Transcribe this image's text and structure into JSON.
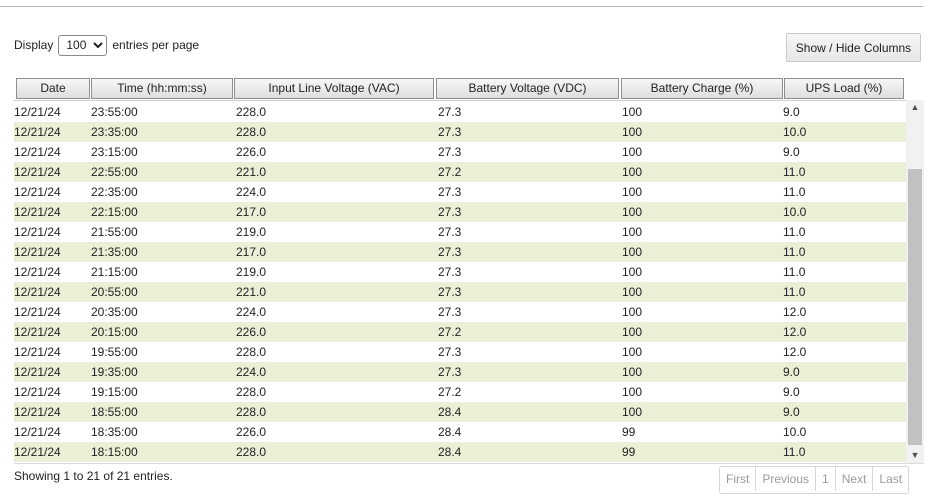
{
  "length_menu": {
    "prefix": "Display",
    "selected": "100",
    "suffix": "entries per page"
  },
  "colvis_label": "Show / Hide Columns",
  "columns": [
    "Date",
    "Time (hh:mm:ss)",
    "Input Line Voltage (VAC)",
    "Battery Voltage (VDC)",
    "Battery Charge (%)",
    "UPS Load (%)"
  ],
  "rows": [
    [
      "12/21/24",
      "23:55:00",
      "228.0",
      "27.3",
      "100",
      "9.0"
    ],
    [
      "12/21/24",
      "23:35:00",
      "228.0",
      "27.3",
      "100",
      "10.0"
    ],
    [
      "12/21/24",
      "23:15:00",
      "226.0",
      "27.3",
      "100",
      "9.0"
    ],
    [
      "12/21/24",
      "22:55:00",
      "221.0",
      "27.2",
      "100",
      "11.0"
    ],
    [
      "12/21/24",
      "22:35:00",
      "224.0",
      "27.3",
      "100",
      "11.0"
    ],
    [
      "12/21/24",
      "22:15:00",
      "217.0",
      "27.3",
      "100",
      "10.0"
    ],
    [
      "12/21/24",
      "21:55:00",
      "219.0",
      "27.3",
      "100",
      "11.0"
    ],
    [
      "12/21/24",
      "21:35:00",
      "217.0",
      "27.3",
      "100",
      "11.0"
    ],
    [
      "12/21/24",
      "21:15:00",
      "219.0",
      "27.3",
      "100",
      "11.0"
    ],
    [
      "12/21/24",
      "20:55:00",
      "221.0",
      "27.3",
      "100",
      "11.0"
    ],
    [
      "12/21/24",
      "20:35:00",
      "224.0",
      "27.3",
      "100",
      "12.0"
    ],
    [
      "12/21/24",
      "20:15:00",
      "226.0",
      "27.2",
      "100",
      "12.0"
    ],
    [
      "12/21/24",
      "19:55:00",
      "228.0",
      "27.3",
      "100",
      "12.0"
    ],
    [
      "12/21/24",
      "19:35:00",
      "224.0",
      "27.3",
      "100",
      "9.0"
    ],
    [
      "12/21/24",
      "19:15:00",
      "228.0",
      "27.2",
      "100",
      "9.0"
    ],
    [
      "12/21/24",
      "18:55:00",
      "228.0",
      "28.4",
      "100",
      "9.0"
    ],
    [
      "12/21/24",
      "18:35:00",
      "226.0",
      "28.4",
      "99",
      "10.0"
    ],
    [
      "12/21/24",
      "18:15:00",
      "228.0",
      "28.4",
      "99",
      "11.0"
    ]
  ],
  "info_text": "Showing 1 to 21 of 21 entries.",
  "pagination": {
    "first": "First",
    "previous": "Previous",
    "page": "1",
    "next": "Next",
    "last": "Last"
  },
  "icons": {
    "scroll_up": "chevron-up-icon",
    "scroll_down": "chevron-down-icon"
  },
  "colors": {
    "row_stripe": "#eaf0d6",
    "header_border": "#8f8f8f"
  }
}
